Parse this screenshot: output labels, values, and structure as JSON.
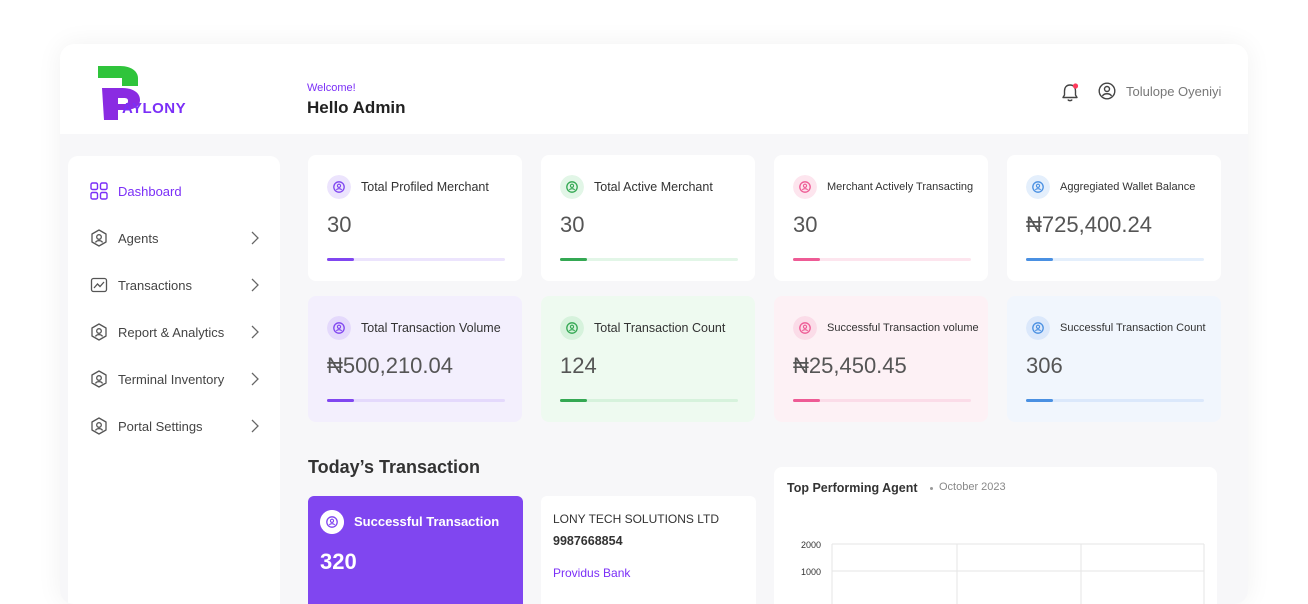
{
  "brand": {
    "logo_text": "AYLONY"
  },
  "header": {
    "welcome": "Welcome!",
    "greeting": "Hello Admin",
    "user_name": "Tolulope Oyeniyi"
  },
  "sidebar": {
    "items": [
      {
        "label": "Dashboard",
        "icon": "grid-icon",
        "active": true
      },
      {
        "label": "Agents",
        "icon": "user-badge-icon"
      },
      {
        "label": "Transactions",
        "icon": "chart-line-icon"
      },
      {
        "label": "Report & Analytics",
        "icon": "user-badge-icon"
      },
      {
        "label": "Terminal Inventory",
        "icon": "user-badge-icon"
      },
      {
        "label": "Portal Settings",
        "icon": "user-badge-icon"
      }
    ]
  },
  "stats": [
    {
      "title": "Total Profiled Merchant",
      "value": "30",
      "progress": 0.15,
      "color": "#8046f0"
    },
    {
      "title": "Total Active Merchant",
      "value": "30",
      "progress": 0.15,
      "color": "#34a853"
    },
    {
      "title": "Merchant Actively Transacting",
      "value": "30",
      "progress": 0.15,
      "color": "#ee5b95"
    },
    {
      "title": "Aggregiated Wallet Balance",
      "value": "₦725,400.24",
      "progress": 0.15,
      "color": "#4a90e2"
    },
    {
      "title": "Total Transaction Volume",
      "value": "₦500,210.04",
      "progress": 0.15,
      "color": "#8046f0"
    },
    {
      "title": "Total Transaction Count",
      "value": "124",
      "progress": 0.15,
      "color": "#34a853"
    },
    {
      "title": "Successful Transaction volume",
      "value": "₦25,450.45",
      "progress": 0.15,
      "color": "#ee5b95"
    },
    {
      "title": "Successful Transaction Count",
      "value": "306",
      "progress": 0.15,
      "color": "#4a90e2"
    }
  ],
  "today": {
    "title": "Today’s Transaction",
    "success_label": "Successful Transaction",
    "success_value": "320",
    "account_name": "LONY TECH SOLUTIONS LTD",
    "account_number": "9987668854",
    "bank": "Providus Bank"
  },
  "top_agent": {
    "title": "Top Performing Agent",
    "period": "October 2023",
    "y_ticks": [
      "2000",
      "1000"
    ]
  },
  "colors": {
    "accent": "#7b2ff7",
    "purple": "#8046f0",
    "green": "#34a853",
    "pink": "#ee5b95",
    "blue": "#4a90e2"
  }
}
